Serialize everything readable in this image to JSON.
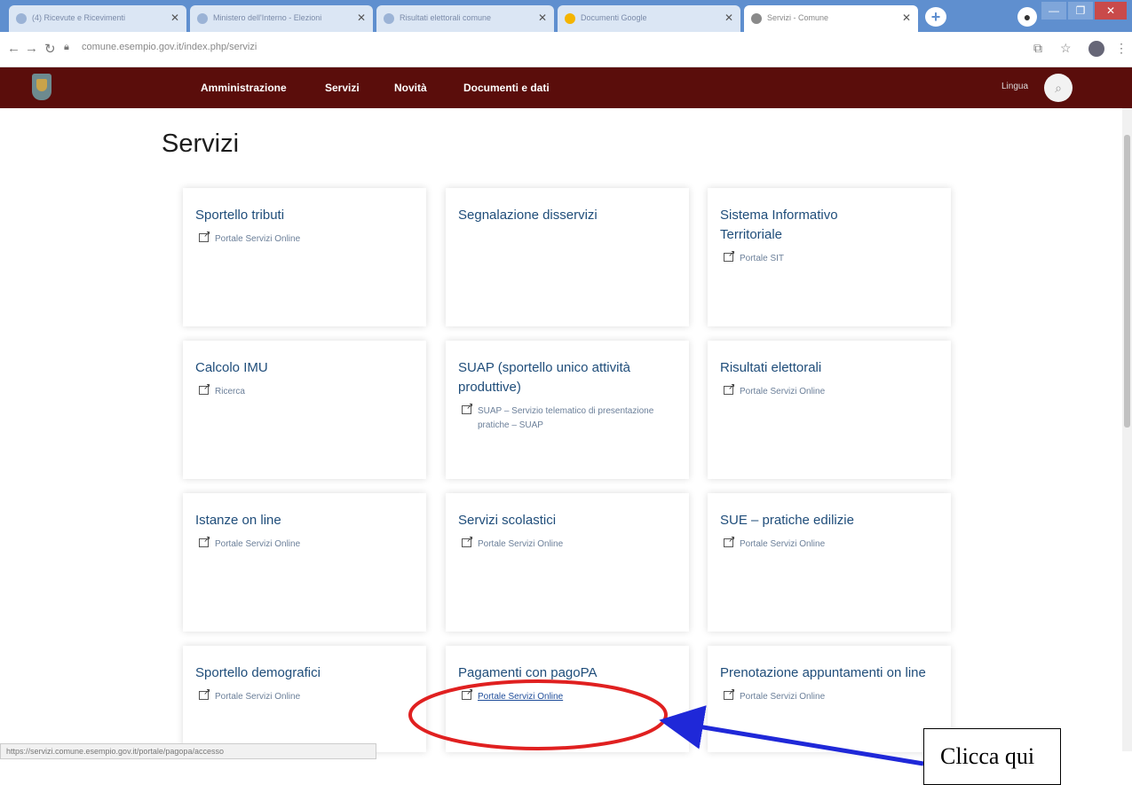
{
  "browser": {
    "tabs": [
      {
        "title": "(4) Ricevute e Ricevimenti"
      },
      {
        "title": "Ministero dell'Interno - Elezioni"
      },
      {
        "title": "Risultati elettorali comune"
      },
      {
        "title": "Documenti Google"
      },
      {
        "title": "Servizi - Comune"
      }
    ],
    "new_tab_symbol": "+",
    "url": "comune.esempio.gov.it/index.php/servizi",
    "window_buttons": [
      "—",
      "❐",
      "✕"
    ]
  },
  "site": {
    "menu": [
      "Amministrazione",
      "Servizi",
      "Novità",
      "Documenti e dati"
    ],
    "language": "Lingua",
    "header_color": "#5a0d0b"
  },
  "page": {
    "title": "Servizi",
    "cards": [
      {
        "title": "Sportello tributi",
        "links": [
          "Portale Servizi Online"
        ]
      },
      {
        "title": "Segnalazione disservizi",
        "links": []
      },
      {
        "title": "Sistema Informativo Territoriale",
        "links": [
          "Portale SIT"
        ]
      },
      {
        "title": "Calcolo IMU",
        "links": [
          "Ricerca"
        ]
      },
      {
        "title": "SUAP (sportello unico attività produttive)",
        "links": [
          "SUAP – Servizio telematico di presentazione pratiche – SUAP"
        ]
      },
      {
        "title": "Risultati elettorali",
        "links": [
          "Portale Servizi Online"
        ]
      },
      {
        "title": "Istanze on line",
        "links": [
          "Portale Servizi Online"
        ]
      },
      {
        "title": "Servizi scolastici",
        "links": [
          "Portale Servizi Online"
        ]
      },
      {
        "title": "SUE – pratiche edilizie",
        "links": [
          "Portale Servizi Online"
        ]
      },
      {
        "title": "Sportello demografici",
        "links": [
          "Portale Servizi Online"
        ]
      },
      {
        "title": "Pagamenti con pagoPA",
        "links": [
          "Portale Servizi Online"
        ]
      },
      {
        "title": "Prenotazione appuntamenti on line",
        "links": [
          "Portale Servizi Online"
        ]
      }
    ]
  },
  "status_bar": "https://servizi.comune.esempio.gov.it/portale/pagopa/accesso",
  "annotation": {
    "callout_text": "Clicca qui",
    "ellipse_color": "#e02020",
    "arrow_color": "#1f28d8"
  }
}
